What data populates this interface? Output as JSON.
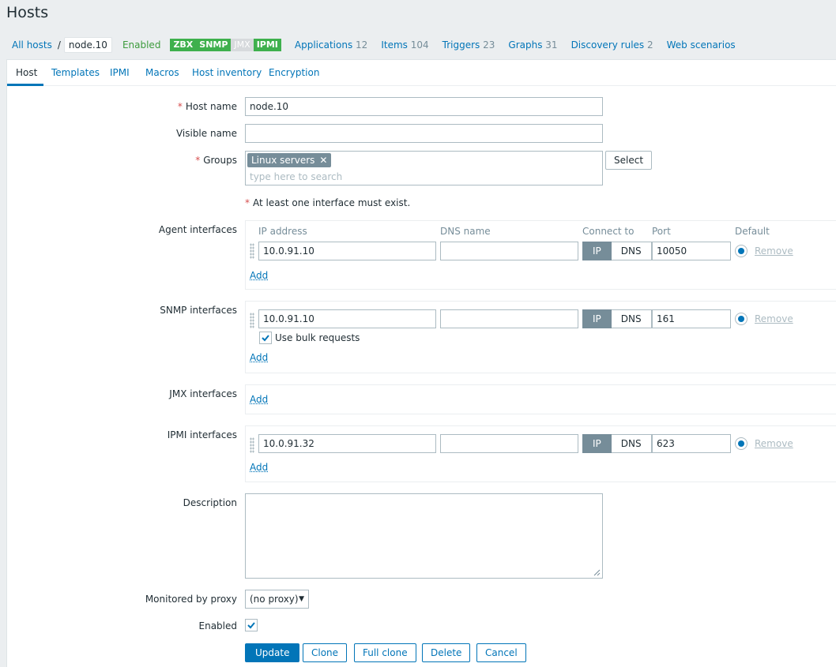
{
  "page": {
    "title": "Hosts"
  },
  "breadcrumb": {
    "all_hosts": "All hosts",
    "separator": "/",
    "current": "node.10",
    "status": "Enabled",
    "badges": [
      {
        "label": "ZBX",
        "state": "on"
      },
      {
        "label": "SNMP",
        "state": "on"
      },
      {
        "label": "JMX",
        "state": "off"
      },
      {
        "label": "IPMI",
        "state": "on"
      }
    ],
    "links": [
      {
        "label": "Applications",
        "count": "12"
      },
      {
        "label": "Items",
        "count": "104"
      },
      {
        "label": "Triggers",
        "count": "23"
      },
      {
        "label": "Graphs",
        "count": "31"
      },
      {
        "label": "Discovery rules",
        "count": "2"
      },
      {
        "label": "Web scenarios",
        "count": ""
      }
    ]
  },
  "tabs": [
    "Host",
    "Templates",
    "IPMI",
    "Macros",
    "Host inventory",
    "Encryption"
  ],
  "form": {
    "host_name_label": "Host name",
    "host_name_value": "node.10",
    "visible_name_label": "Visible name",
    "visible_name_value": "",
    "groups_label": "Groups",
    "group_chip": "Linux servers",
    "groups_placeholder": "type here to search",
    "select_button": "Select",
    "interface_note": "At least one interface must exist.",
    "required_mark": "*",
    "columns": {
      "ip": "IP address",
      "dns": "DNS name",
      "connect": "Connect to",
      "port": "Port",
      "default": "Default"
    },
    "agent": {
      "label": "Agent interfaces",
      "ip": "10.0.91.10",
      "dns": "",
      "port": "10050"
    },
    "snmp": {
      "label": "SNMP interfaces",
      "ip": "10.0.91.10",
      "dns": "",
      "port": "161",
      "bulk_label": "Use bulk requests"
    },
    "jmx": {
      "label": "JMX interfaces"
    },
    "ipmi": {
      "label": "IPMI interfaces",
      "ip": "10.0.91.32",
      "dns": "",
      "port": "623"
    },
    "connect_ip": "IP",
    "connect_dns": "DNS",
    "remove_link": "Remove",
    "add_link": "Add",
    "description_label": "Description",
    "proxy_label": "Monitored by proxy",
    "proxy_value": "(no proxy)",
    "enabled_label": "Enabled",
    "buttons": {
      "update": "Update",
      "clone": "Clone",
      "full_clone": "Full clone",
      "delete": "Delete",
      "cancel": "Cancel"
    }
  }
}
